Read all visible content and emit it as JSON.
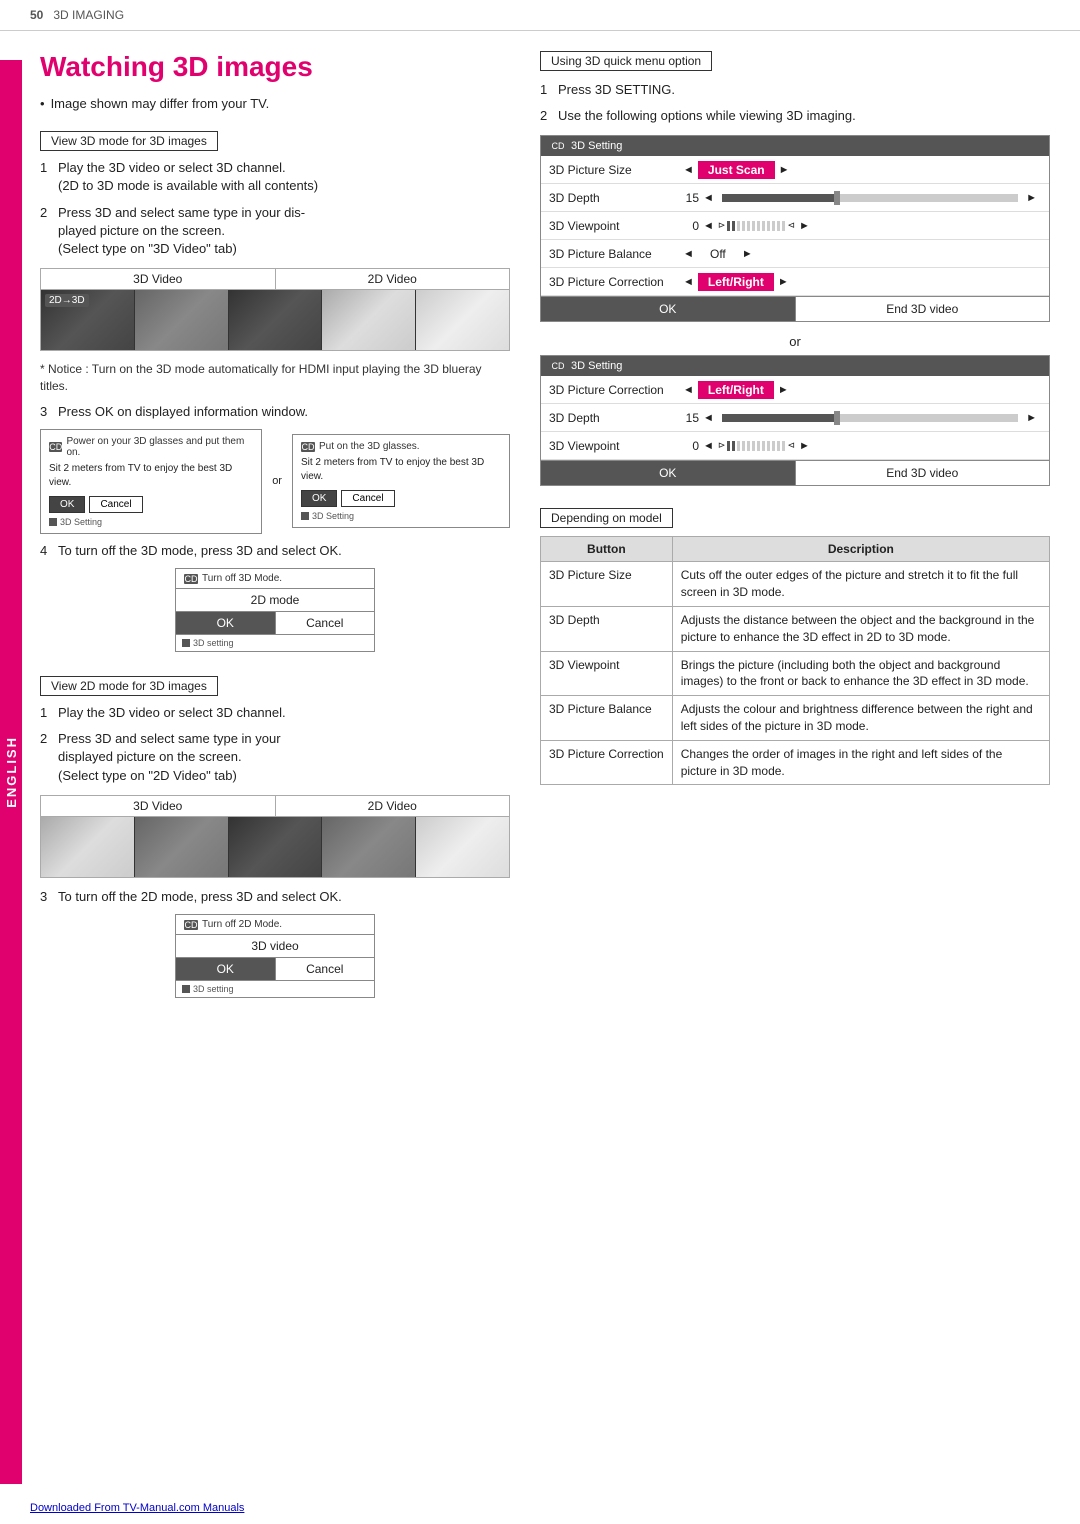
{
  "header": {
    "page_num": "50",
    "section": "3D IMAGING"
  },
  "title": "Watching 3D images",
  "intro_bullet": "Image shown may differ from your TV.",
  "view3d_section": {
    "label": "View 3D mode for 3D images",
    "steps": [
      {
        "num": "1",
        "text": "Play the 3D video or select 3D channel.\n(2D to 3D mode is available with all contents)"
      },
      {
        "num": "2",
        "text": "Press 3D and select same type in your displayed picture on the screen.\n(Select type on \"3D Video\" tab)"
      }
    ],
    "video_box": {
      "col1": "3D Video",
      "col2": "2D Video"
    },
    "badge": "2D→3D",
    "note": "* Notice : Turn on the 3D mode automatically for HDMI input playing the 3D blueray titles.",
    "step3": "Press OK on displayed information window.",
    "dialog1": {
      "icon": "CD",
      "text": "Power on your 3D glasses and put them on.\nSit 2 meters from TV to enjoy the best 3D view.",
      "btn_ok": "OK",
      "btn_cancel": "Cancel",
      "footer": "3D Setting"
    },
    "dialog2": {
      "icon": "CD",
      "text": "Put on the 3D glasses.\nSit 2 meters from TV to enjoy the best 3D view.",
      "btn_ok": "OK",
      "btn_cancel": "Cancel",
      "footer": "3D Setting"
    },
    "or_text": "or",
    "step4": "To turn off the 3D mode, press 3D and select OK.",
    "turnoff_box": {
      "icon": "CD",
      "title": "Turn off 3D Mode.",
      "mode": "2D mode",
      "btn_ok": "OK",
      "btn_cancel": "Cancel",
      "footer": "3D setting"
    }
  },
  "view2d_section": {
    "label": "View 2D mode for 3D images",
    "steps": [
      {
        "num": "1",
        "text": "Play the 3D video or select 3D channel."
      },
      {
        "num": "2",
        "text": "Press 3D and select same type in your displayed picture on the screen.\n(Select type on \"2D Video\" tab)"
      }
    ],
    "video_box": {
      "col1": "3D Video",
      "col2": "2D Video"
    },
    "step3": "To turn off the 2D mode, press 3D and select OK.",
    "turnoff_box": {
      "icon": "CD",
      "title": "Turn off 2D Mode.",
      "mode": "3D video",
      "btn_ok": "OK",
      "btn_cancel": "Cancel",
      "footer": "3D setting"
    }
  },
  "right_col": {
    "quick_menu_label": "Using 3D quick menu option",
    "step1": "Press 3D SETTING.",
    "step2": "Use the following options while viewing 3D imaging.",
    "panel1": {
      "title": "3D Setting",
      "rows": [
        {
          "name": "3D Picture Size",
          "value": "Just Scan",
          "highlight": true
        },
        {
          "name": "3D Depth",
          "num": "15",
          "has_bar": true
        },
        {
          "name": "3D Viewpoint",
          "num": "0",
          "has_vp": true
        },
        {
          "name": "3D Picture Balance",
          "value": "Off"
        },
        {
          "name": "3D Picture Correction",
          "value": "Left/Right",
          "highlight": true
        }
      ],
      "btn_ok": "OK",
      "btn_end": "End 3D video"
    },
    "or_text": "or",
    "panel2": {
      "title": "3D Setting",
      "rows": [
        {
          "name": "3D Picture Correction",
          "value": "Left/Right",
          "highlight": true
        },
        {
          "name": "3D Depth",
          "num": "15",
          "has_bar": true
        },
        {
          "name": "3D Viewpoint",
          "num": "0",
          "has_vp": true
        }
      ],
      "btn_ok": "OK",
      "btn_end": "End 3D video"
    },
    "depends_label": "Depending on model",
    "table": {
      "headers": [
        "Button",
        "Description"
      ],
      "rows": [
        {
          "button": "3D Picture Size",
          "desc": "Cuts off the outer edges of the picture and stretch it to fit the full screen in 3D mode."
        },
        {
          "button": "3D Depth",
          "desc": "Adjusts the distance between the object and the background in the picture to enhance the 3D effect in 2D to 3D mode."
        },
        {
          "button": "3D Viewpoint",
          "desc": "Brings the picture (including both the object and background images) to the front or back to enhance the 3D effect in 3D mode."
        },
        {
          "button": "3D Picture Balance",
          "desc": "Adjusts the colour and brightness difference between the right and left sides of the picture in 3D mode."
        },
        {
          "button": "3D Picture Correction",
          "desc": "Changes the order of images in the right and left sides of the picture in 3D mode."
        }
      ]
    }
  },
  "english_label": "ENGLISH",
  "footer_link": "Downloaded From TV-Manual.com Manuals"
}
